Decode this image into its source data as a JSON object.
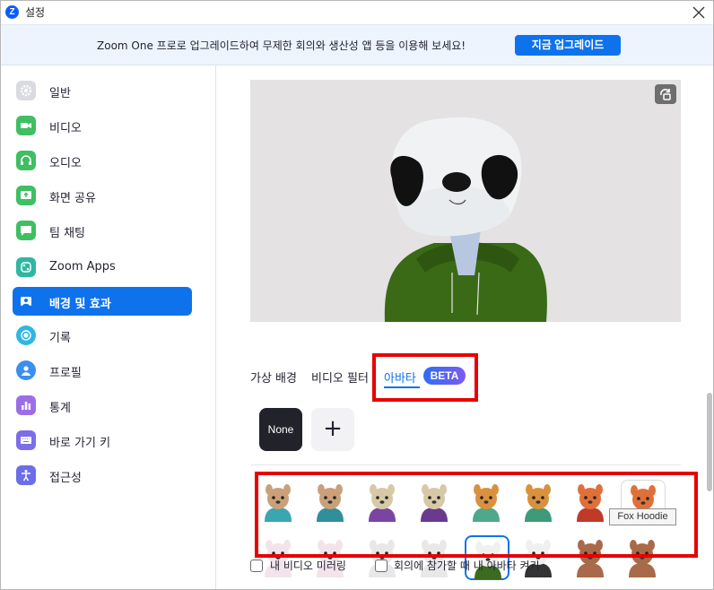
{
  "window": {
    "title": "설정",
    "logo_letter": "Z"
  },
  "banner": {
    "text": "Zoom One 프로로 업그레이드하여 무제한 회의와 생산성 앱 등을 이용해 보세요!",
    "button_label": "지금 업그레이드"
  },
  "sidebar": {
    "items": [
      {
        "label": "일반",
        "icon": "gear-icon",
        "color": "#d9dbe0"
      },
      {
        "label": "비디오",
        "icon": "video-camera-icon",
        "color": "#3fbf62"
      },
      {
        "label": "오디오",
        "icon": "headphones-icon",
        "color": "#3fbf62"
      },
      {
        "label": "화면 공유",
        "icon": "share-screen-icon",
        "color": "#3fbf62"
      },
      {
        "label": "팀 채팅",
        "icon": "chat-icon",
        "color": "#3fbf62"
      },
      {
        "label": "Zoom Apps",
        "icon": "apps-icon",
        "color": "#2fb7a3"
      },
      {
        "label": "배경 및 효과",
        "icon": "background-icon",
        "color": "#ffffff",
        "active": true
      },
      {
        "label": "기록",
        "icon": "record-icon",
        "color": "#2fb7e0"
      },
      {
        "label": "프로필",
        "icon": "profile-icon",
        "color": "#3a8ff0"
      },
      {
        "label": "통계",
        "icon": "statistics-icon",
        "color": "#9b6ee8"
      },
      {
        "label": "바로 가기 키",
        "icon": "keyboard-icon",
        "color": "#7b6ee8"
      },
      {
        "label": "접근성",
        "icon": "accessibility-icon",
        "color": "#6b6ee8"
      }
    ]
  },
  "main": {
    "tabs": [
      {
        "label": "가상 배경"
      },
      {
        "label": "비디오 필터"
      },
      {
        "label": "아바타",
        "active": true
      }
    ],
    "beta_label": "BETA",
    "none_tile_label": "None",
    "add_tile_label": "+",
    "tooltip": "Fox Hoodie",
    "checkboxes": [
      {
        "label": "내 비디오 미러링",
        "checked": false
      },
      {
        "label": "회의에 참가할 때 내 아바타 켜기",
        "checked": false
      }
    ],
    "avatars": [
      {
        "name": "dog-avatar-teal",
        "head": "#c9a07a",
        "body": "#3aa6b0"
      },
      {
        "name": "dog-avatar-teal-2",
        "head": "#c9a07a",
        "body": "#2f8f9a"
      },
      {
        "name": "sheep-avatar-purple",
        "head": "#d7c9a6",
        "body": "#7a45a0"
      },
      {
        "name": "sheep-avatar-purple-2",
        "head": "#d7c9a6",
        "body": "#6a3a8f"
      },
      {
        "name": "beagle-avatar-green",
        "head": "#d9913e",
        "body": "#4fa88a"
      },
      {
        "name": "beagle-avatar-green-2",
        "head": "#d9913e",
        "body": "#3f9a7a"
      },
      {
        "name": "fox-avatar-red",
        "head": "#e0703a",
        "body": "#c0392b"
      },
      {
        "name": "fox-avatar-hoodie",
        "head": "#e0703a",
        "body": "#b03020"
      },
      {
        "name": "rabbit-avatar",
        "head": "#f2e4ea",
        "body": "#f2e4ea"
      },
      {
        "name": "rabbit-avatar-2",
        "head": "#f2e4ea",
        "body": "#f2e4ea"
      },
      {
        "name": "cat-avatar-white",
        "head": "#e8e8e8",
        "body": "#e8e8e8"
      },
      {
        "name": "cat-avatar-white-2",
        "head": "#e8e8e8",
        "body": "#e8e8e8"
      },
      {
        "name": "panda-avatar",
        "head": "#f0f0f0",
        "body": "#3b6b1f",
        "selected": true
      },
      {
        "name": "panda-avatar-2",
        "head": "#f0f0f0",
        "body": "#333333"
      },
      {
        "name": "bear-avatar",
        "head": "#a86a4a",
        "body": "#a86a4a"
      },
      {
        "name": "bear-avatar-2",
        "head": "#a86a4a",
        "body": "#a86a4a"
      }
    ]
  },
  "colors": {
    "accent": "#0e72ed",
    "highlight": "#e80000",
    "banner_bg": "#eef4fe"
  }
}
